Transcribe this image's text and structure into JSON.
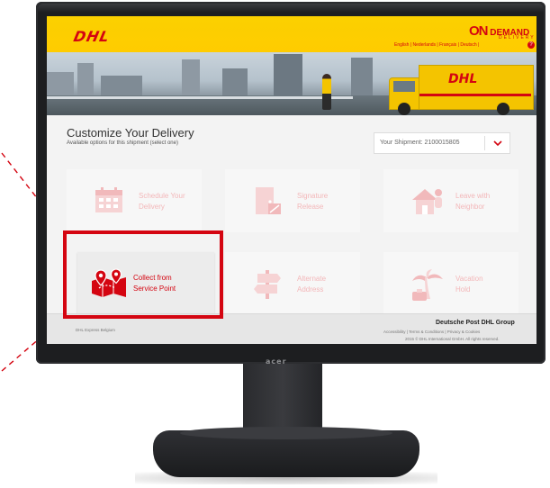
{
  "monitor": {
    "brand": "acer"
  },
  "header": {
    "logo": "DHL",
    "ondemand_on": "ON",
    "ondemand_label": "DEMAND",
    "ondemand_sub": "DELIVERY",
    "languages": "English | Nederlands | Français | Deutsch |",
    "help": "?"
  },
  "banner": {
    "truck_logo": "DHL"
  },
  "content": {
    "title": "Customize Your Delivery",
    "subtitle": "Available options for this shipment (select one)",
    "shipment_label": "Your Shipment: 2100015805"
  },
  "options": [
    {
      "line1": "Schedule Your",
      "line2": "Delivery",
      "icon": "calendar-icon"
    },
    {
      "line1": "Signature",
      "line2": "Release",
      "icon": "door-signature-icon"
    },
    {
      "line1": "Leave with",
      "line2": "Neighbor",
      "icon": "neighbor-house-icon"
    },
    {
      "line1": "Collect from",
      "line2": "Service Point",
      "icon": "map-pins-icon"
    },
    {
      "line1": "Alternate",
      "line2": "Address",
      "icon": "signpost-icon"
    },
    {
      "line1": "Vacation",
      "line2": "Hold",
      "icon": "palm-tree-icon"
    }
  ],
  "footer": {
    "left": "DHL Express Belgium",
    "brand": "Deutsche Post DHL Group",
    "links": "Accessibility  |  Terms & Conditions  |  Privacy & Cookies",
    "copyright": "2015 © DHL International GmbH. All rights reserved."
  },
  "colors": {
    "dhl_yellow": "#ffcc00",
    "dhl_red": "#d40511",
    "bezel": "#1d1e20"
  }
}
